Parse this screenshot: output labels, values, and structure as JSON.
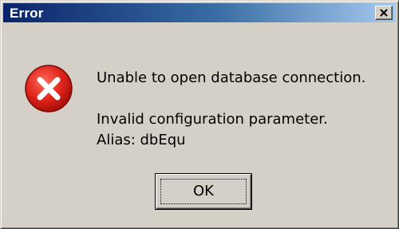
{
  "window": {
    "title": "Error"
  },
  "titlebar": {
    "close_icon": "close-icon"
  },
  "message": {
    "icon": "error-icon",
    "line1": "Unable to open database connection.",
    "line2": "Invalid configuration parameter.",
    "line3": "Alias: dbEqu"
  },
  "buttons": {
    "ok_label": "OK"
  },
  "colors": {
    "title_gradient_start": "#0a246a",
    "title_gradient_end": "#a6caf0",
    "dialog_bg": "#d4d0c8",
    "error_red": "#e0251b"
  }
}
